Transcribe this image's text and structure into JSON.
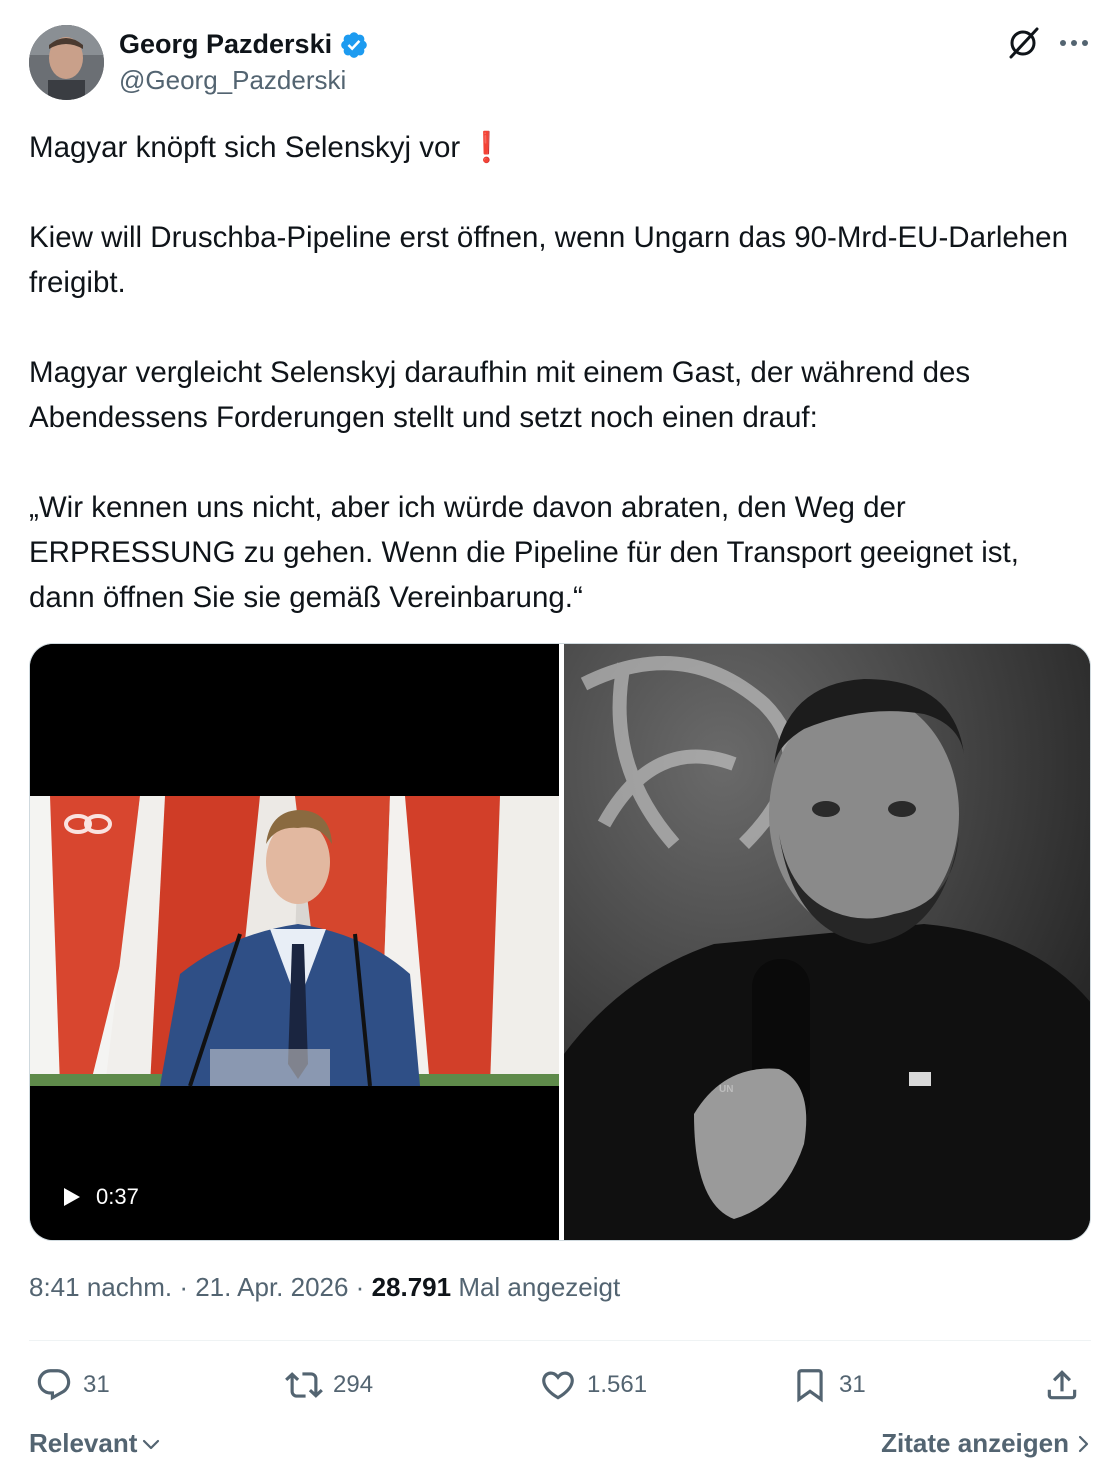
{
  "author": {
    "name": "Georg Pazderski",
    "handle": "@Georg_Pazderski",
    "verified": true,
    "verified_color": "#1d9bf0"
  },
  "header_icons": [
    "grok-icon",
    "more-icon"
  ],
  "tweet": {
    "line1": "Magyar knöpft sich Selenskyj vor",
    "line1_emoji": "❗",
    "para2": "Kiew will Druschba-Pipeline erst öffnen, wenn Ungarn das 90-Mrd-EU-Darlehen freigibt.",
    "para3": "Magyar vergleicht Selenskyj daraufhin mit einem Gast, der während des Abendessens Forderungen stellt und setzt noch einen drauf:",
    "para4": "„Wir kennen uns nicht, aber ich würde davon abraten, den Weg der ERPRESSUNG zu gehen. Wenn die Pipeline für den Transport geeignet ist, dann öffnen Sie sie gemäß Vereinbarung.“"
  },
  "media": {
    "video_duration": "0:37"
  },
  "meta": {
    "time": "8:41 nachm.",
    "separator1": " · ",
    "date": "21. Apr. 2026",
    "separator2": " · ",
    "views_count": "28.791",
    "views_label": " Mal angezeigt"
  },
  "actions": {
    "replies": "31",
    "reposts": "294",
    "likes": "1.561",
    "bookmarks": "31"
  },
  "footer": {
    "sort_label": "Relevant",
    "quotes_label": "Zitate anzeigen"
  },
  "colors": {
    "text": "#0f1419",
    "secondary": "#536471",
    "divider": "#eff3f4",
    "emoji_red": "#d9242b"
  }
}
